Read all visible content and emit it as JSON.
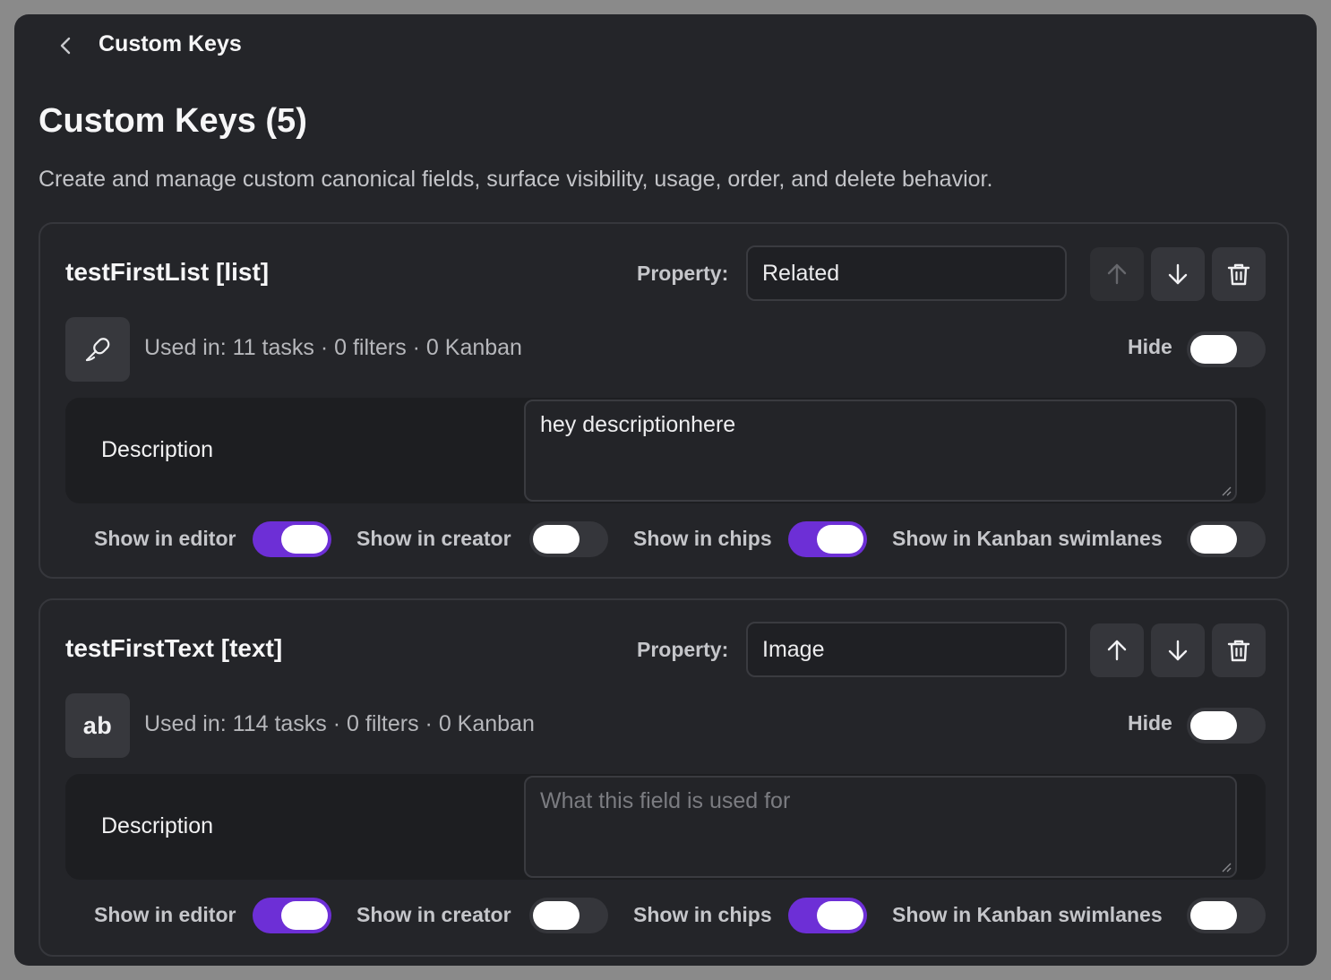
{
  "topbar": {
    "title": "Custom Keys"
  },
  "page": {
    "title": "Custom Keys (5)",
    "subtitle": "Create and manage custom canonical fields, surface visibility, usage, order, and delete behavior."
  },
  "labels": {
    "property": "Property:",
    "hide": "Hide",
    "description": "Description",
    "show_in_editor": "Show in editor",
    "show_in_creator": "Show in creator",
    "show_in_chips": "Show in chips",
    "show_in_kanban": "Show in Kanban swimlanes"
  },
  "keys": [
    {
      "name": "testFirstList [list]",
      "property": "Related",
      "type_icon": "link-chain-icon",
      "usage": "Used in: 11 tasks · 0 filters · 0 Kanban",
      "description": "hey descriptionhere",
      "description_placeholder": "What this field is used for",
      "hide": false,
      "move_up_enabled": false,
      "show_in_editor": true,
      "show_in_creator": false,
      "show_in_chips": true,
      "show_in_kanban": false
    },
    {
      "name": "testFirstText [text]",
      "property": "Image",
      "type_icon": "text-ab-icon",
      "type_text": "ab",
      "usage": "Used in: 114 tasks · 0 filters · 0 Kanban",
      "description": "",
      "description_placeholder": "What this field is used for",
      "hide": false,
      "move_up_enabled": true,
      "show_in_editor": true,
      "show_in_creator": false,
      "show_in_chips": true,
      "show_in_kanban": false
    }
  ],
  "colors": {
    "window_bg": "#242529",
    "accent": "#6d2fd6",
    "card_border": "#36373c"
  }
}
